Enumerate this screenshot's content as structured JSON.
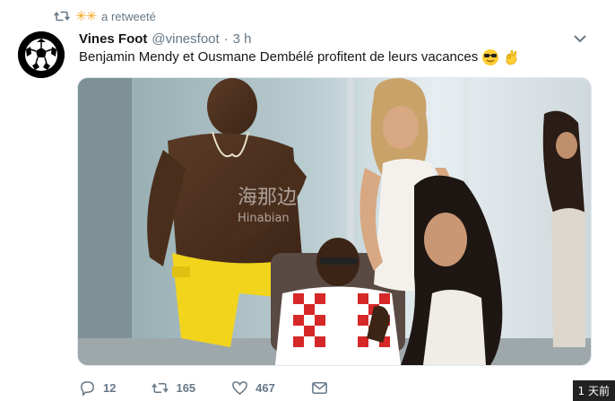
{
  "retweet": {
    "icon": "retweet-icon",
    "user_emoji": "✳✳",
    "label": "a retweeté"
  },
  "tweet": {
    "display_name": "Vines Foot",
    "handle": "@vinesfoot",
    "separator": "·",
    "time": "3 h",
    "text": "Benjamin Mendy et Ousmane Dembélé profitent de leurs vacances",
    "emojis": [
      "sunglasses-face",
      "ok-hand"
    ],
    "media": {
      "watermark_cn": "海那边",
      "watermark_en": "Hinabian"
    }
  },
  "actions": {
    "reply_count": "12",
    "retweet_count": "165",
    "like_count": "467"
  },
  "corner_badge": "1 天前",
  "colors": {
    "text_secondary": "#657786",
    "text_primary": "#14171a",
    "star": "#f5a623"
  }
}
